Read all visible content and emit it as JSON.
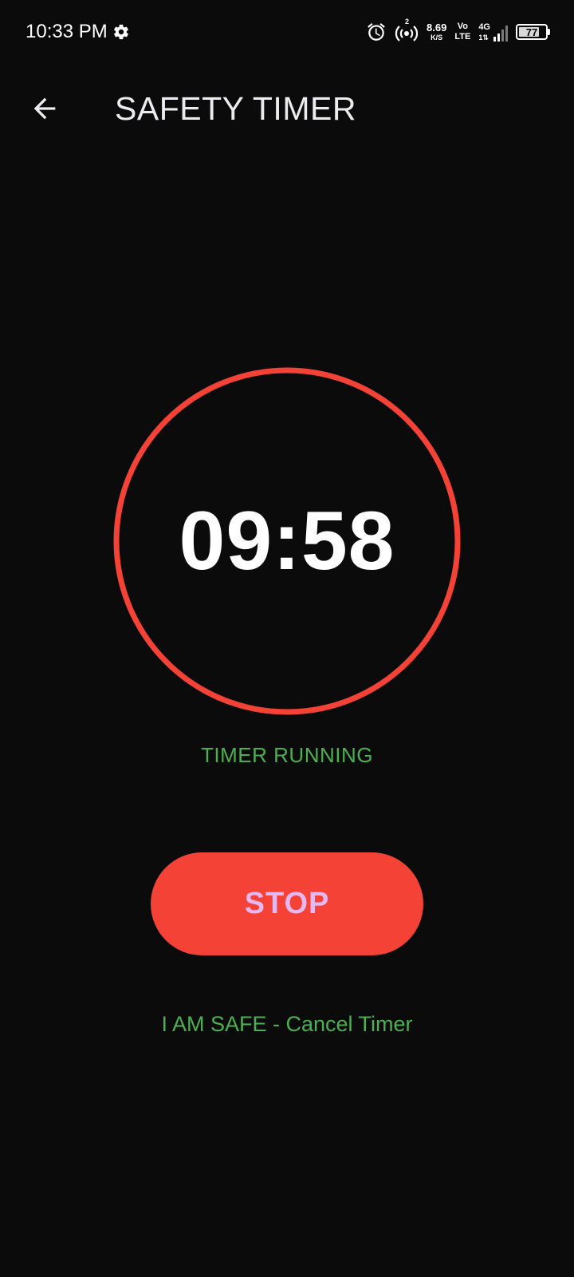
{
  "status_bar": {
    "time": "10:33 PM",
    "hotspot_count": "2",
    "net_speed_value": "8.69",
    "net_speed_unit": "K/S",
    "volte_line1": "Vo",
    "volte_line2": "LTE",
    "network_type": "4G",
    "network_sub": "1⇅",
    "battery_level": "77",
    "battery_fraction": 0.77,
    "icons": [
      "settings-gear-icon",
      "alarm-clock-icon",
      "hotspot-icon",
      "signal-icon",
      "battery-icon"
    ]
  },
  "header": {
    "title": "SAFETY TIMER",
    "back_icon": "arrow-left-icon"
  },
  "timer": {
    "value": "09:58",
    "status": "TIMER RUNNING",
    "ring_color": "#f44336"
  },
  "actions": {
    "stop_label": "STOP",
    "cancel_label": "I AM SAFE - Cancel Timer"
  },
  "colors": {
    "background": "#0b0b0c",
    "accent_red": "#f44336",
    "status_green": "#4caf50",
    "stop_label": "#e6b8f2"
  }
}
